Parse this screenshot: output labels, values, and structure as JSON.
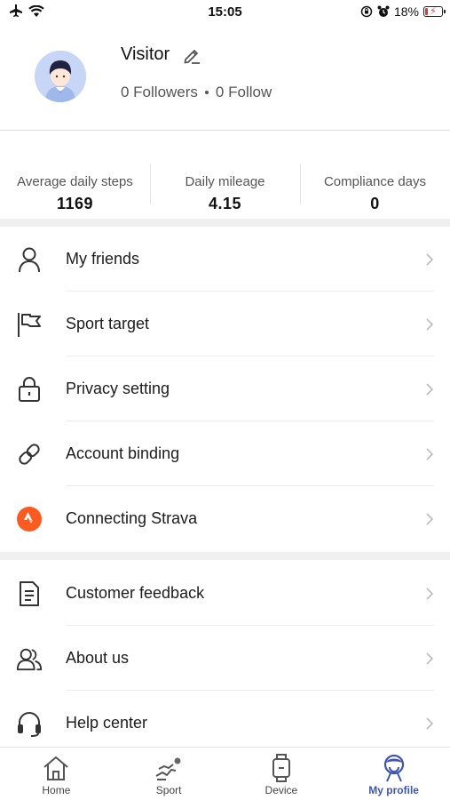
{
  "status_bar": {
    "time": "15:05",
    "battery_text": "18%",
    "battery_level": 0.18,
    "icons": [
      "airplane-icon",
      "wifi-icon",
      "rotation-lock-icon",
      "alarm-icon",
      "battery-icon"
    ]
  },
  "profile": {
    "name": "Visitor",
    "followers": "0 Followers",
    "follow": "0 Follow",
    "icons": [
      "avatar-icon",
      "edit-pencil-icon"
    ]
  },
  "stats": [
    {
      "label": "Average daily steps",
      "value": "1169"
    },
    {
      "label": "Daily mileage",
      "value": "4.15"
    },
    {
      "label": "Compliance days",
      "value": "0"
    }
  ],
  "menu": {
    "group1": [
      {
        "label": "My friends",
        "icon": "user-icon"
      },
      {
        "label": "Sport target",
        "icon": "flag-icon"
      },
      {
        "label": "Privacy setting",
        "icon": "lock-icon"
      },
      {
        "label": "Account binding",
        "icon": "link-icon"
      },
      {
        "label": "Connecting Strava",
        "icon": "strava-icon"
      }
    ],
    "group2": [
      {
        "label": "Customer feedback",
        "icon": "document-icon"
      },
      {
        "label": "About us",
        "icon": "users-icon"
      },
      {
        "label": "Help center",
        "icon": "headset-icon"
      }
    ]
  },
  "tabs": [
    {
      "label": "Home",
      "icon": "home-icon"
    },
    {
      "label": "Sport",
      "icon": "running-icon"
    },
    {
      "label": "Device",
      "icon": "watch-icon"
    },
    {
      "label": "My profile",
      "icon": "profile-icon",
      "active": true
    }
  ],
  "colors": {
    "accent": "#3f55b5",
    "strava": "#fc5a1f",
    "battery_low": "#e53935"
  }
}
